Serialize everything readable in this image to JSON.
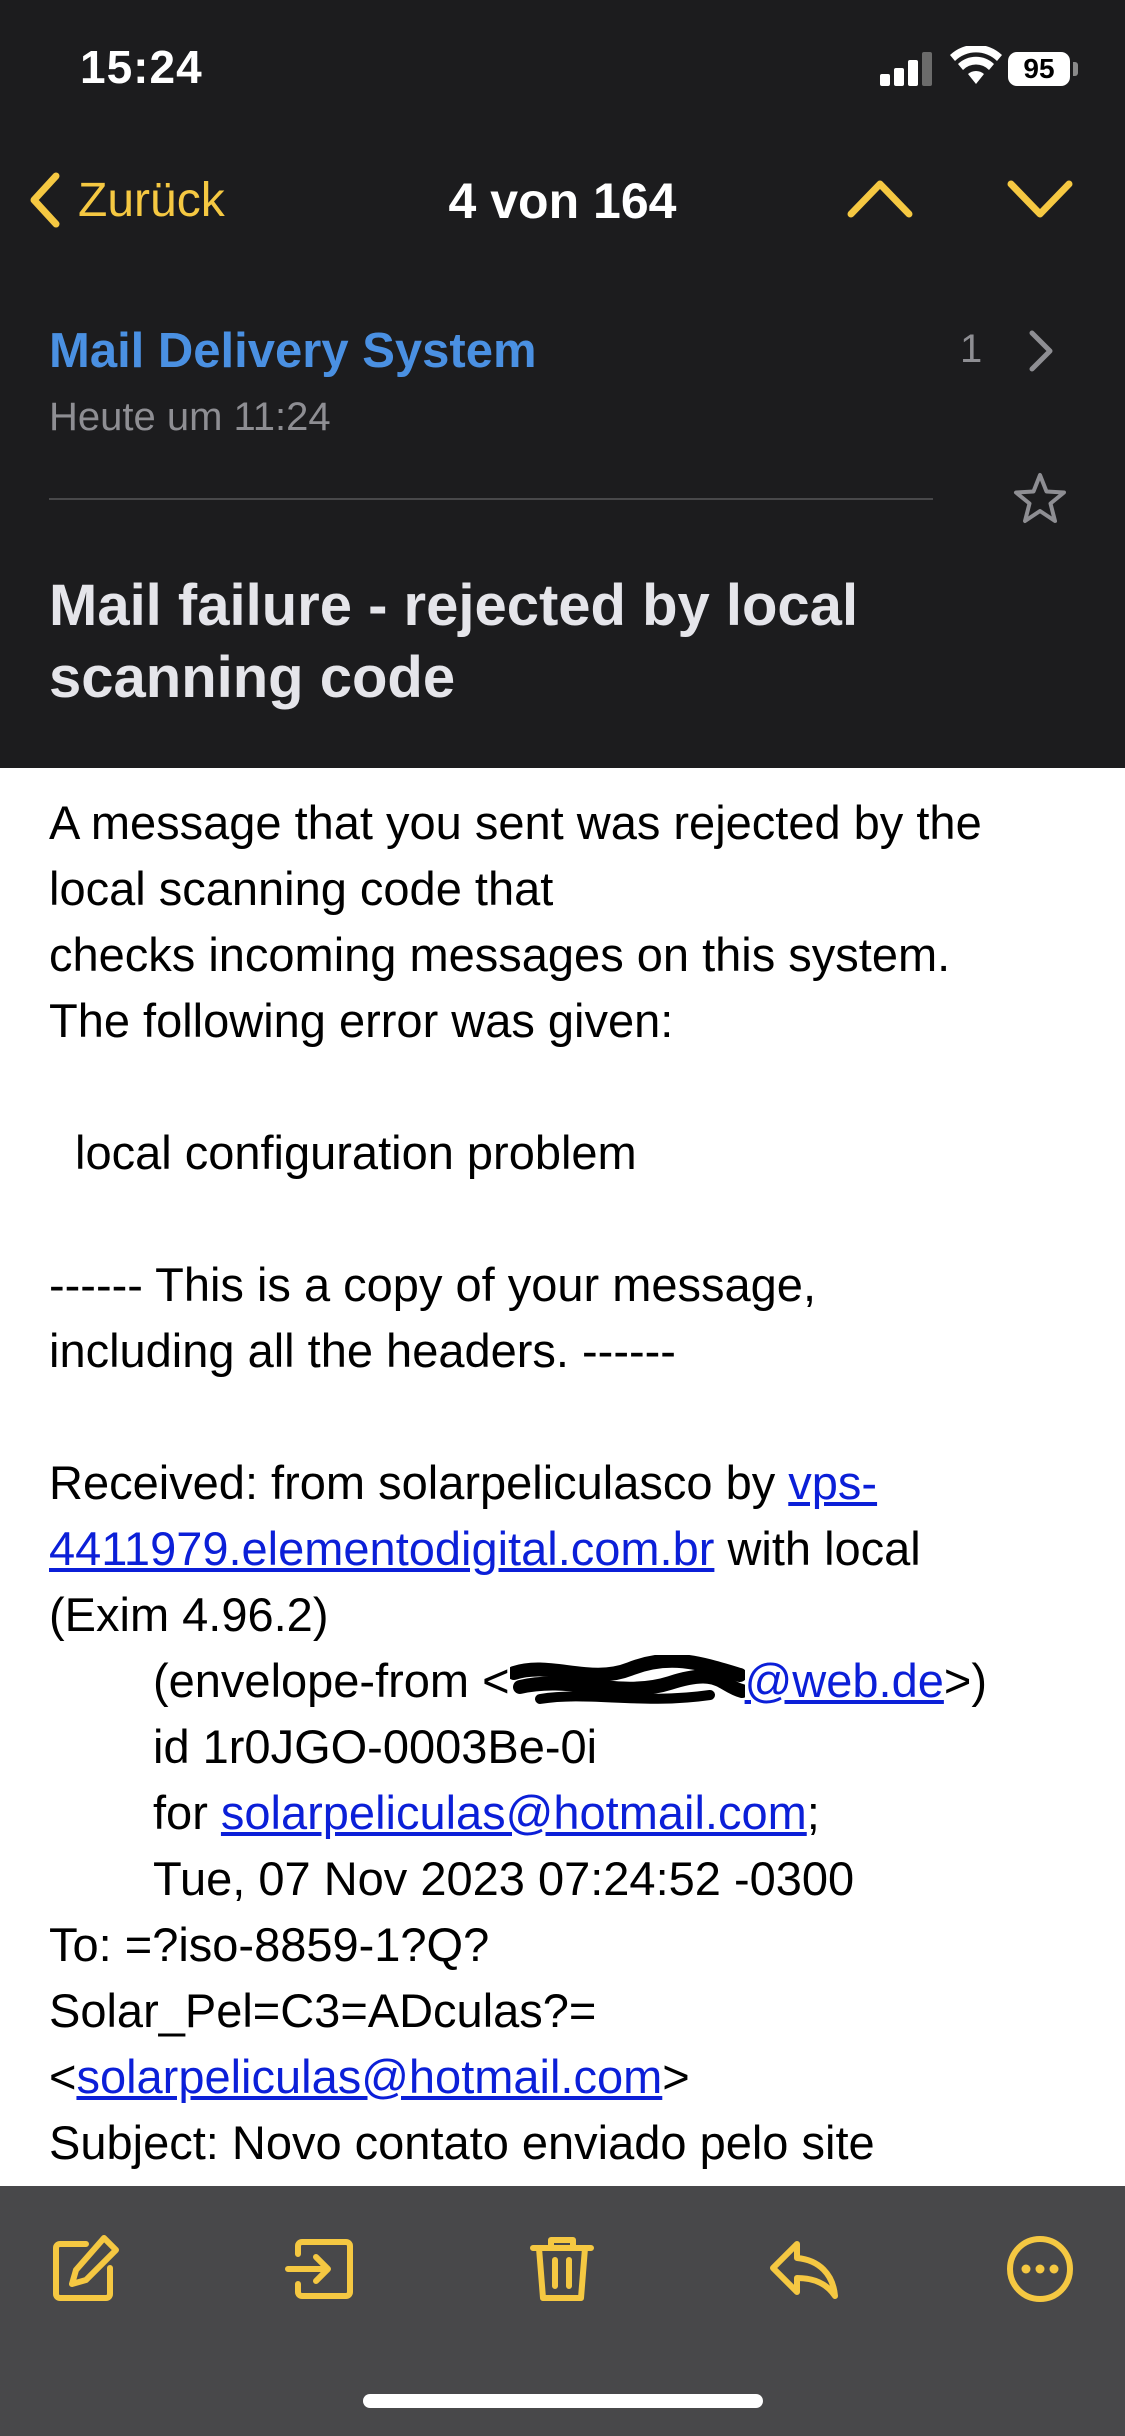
{
  "status_bar": {
    "time": "15:24",
    "battery": "95"
  },
  "nav": {
    "back_label": "Zurück",
    "position": "4 von 164"
  },
  "message": {
    "sender": "Mail Delivery System",
    "date": "Heute um 11:24",
    "thread_count": "1",
    "subject": "Mail failure - rejected by local scanning code"
  },
  "body": {
    "p1": "A message that you sent was rejected by the",
    "p2": "local scanning code that",
    "p3": "checks incoming messages on this system.",
    "p4": "The following error was given:",
    "p5": "local configuration problem",
    "p6": "------ This is a copy of your message,",
    "p7": "including all the headers. ------",
    "r1_pre": "Received: from solarpeliculasco by ",
    "r1_link": "vps-",
    "r2_link": "4411979.elementodigital.com.br",
    "r2_post": " with local",
    "r3": "(Exim 4.96.2)",
    "r4_pre": "(envelope-from <",
    "r4_link": "@web.de",
    "r4_post": ">)",
    "r5": "id 1r0JGO-0003Be-0i",
    "r6_pre": "for ",
    "r6_link": "solarpeliculas@hotmail.com",
    "r6_post": ";",
    "r7": "Tue, 07 Nov 2023 07:24:52 -0300",
    "to1": "To: =?iso-8859-1?Q?",
    "to2": "Solar_Pel=C3=ADculas?=",
    "to3_pre": "<",
    "to3_link": "solarpeliculas@hotmail.com",
    "to3_post": ">",
    "subj": "Subject: Novo contato enviado pelo site"
  },
  "toolbar": {
    "icons": [
      "compose-icon",
      "move-to-folder-icon",
      "trash-icon",
      "reply-icon",
      "more-icon"
    ]
  },
  "colors": {
    "accent": "#f5c842",
    "sender": "#4a90e2",
    "link": "#0b1fd8",
    "dark_bg": "#1c1c1e",
    "toolbar_bg": "#48484a"
  }
}
